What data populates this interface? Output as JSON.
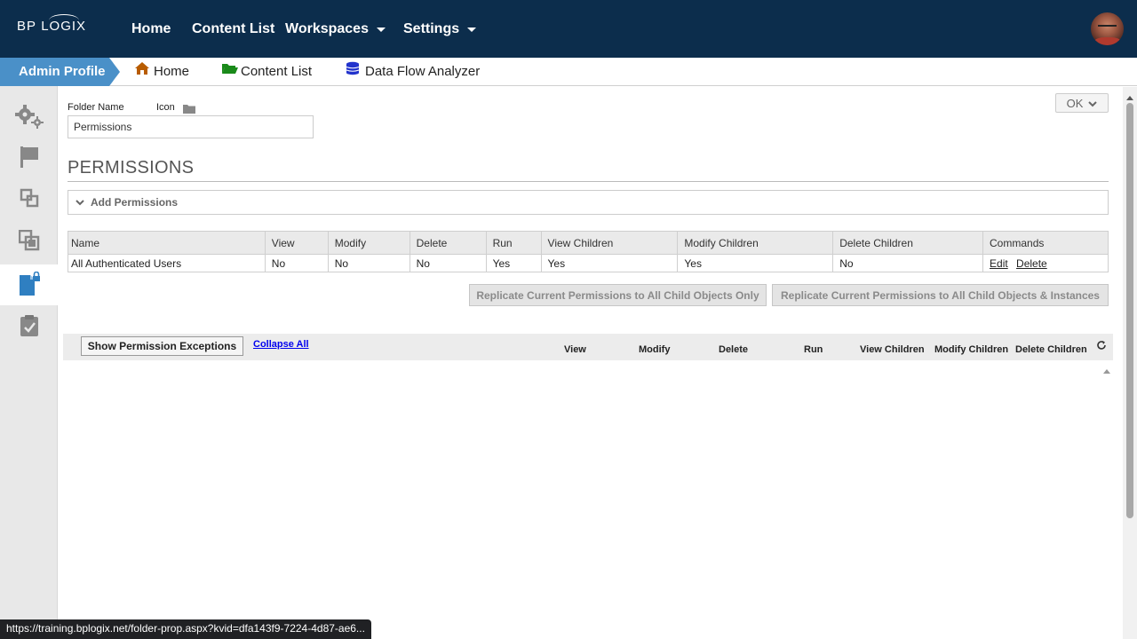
{
  "topnav": {
    "logo_left": "BP",
    "logo_right": "LOGIX",
    "items": [
      {
        "label": "Home"
      },
      {
        "label": "Content List"
      },
      {
        "label": "Workspaces"
      },
      {
        "label": "Settings"
      }
    ]
  },
  "breadcrumb": {
    "admin_label": "Admin Profile",
    "home": "Home",
    "content_list": "Content List",
    "data_flow": "Data Flow Analyzer"
  },
  "form": {
    "folder_name_label": "Folder Name",
    "icon_label": "Icon",
    "folder_name_value": "Permissions",
    "ok_label": "OK"
  },
  "permissions": {
    "title": "PERMISSIONS",
    "add_label": "Add Permissions",
    "columns": [
      "Name",
      "View",
      "Modify",
      "Delete",
      "Run",
      "View Children",
      "Modify Children",
      "Delete Children",
      "Commands"
    ],
    "rows": [
      {
        "name": "All Authenticated Users",
        "view": "No",
        "modify": "No",
        "delete": "No",
        "run": "Yes",
        "view_children": "Yes",
        "modify_children": "Yes",
        "delete_children": "No",
        "edit": "Edit",
        "delete_cmd": "Delete"
      }
    ],
    "replicate_only": "Replicate Current Permissions to All Child Objects Only",
    "replicate_instances": "Replicate Current Permissions to All Child Objects & Instances"
  },
  "exceptions": {
    "show_label": "Show Permission Exceptions",
    "collapse_label": "Collapse All",
    "columns": [
      "View",
      "Modify",
      "Delete",
      "Run",
      "View Children",
      "Modify Children",
      "Delete Children"
    ]
  },
  "status_url": "https://training.bplogix.net/folder-prop.aspx?kvid=dfa143f9-7224-4d87-ae6...",
  "colors": {
    "nav_bg": "#0c2d4c",
    "admin_tab": "#4a90c8",
    "home_icon": "#b85c00",
    "folder_icon": "#1a8a1a",
    "db_icon": "#2233cc"
  }
}
